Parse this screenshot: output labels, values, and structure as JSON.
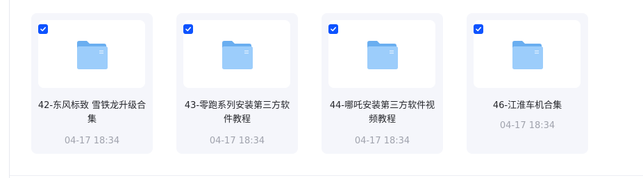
{
  "colors": {
    "accent": "#0d53ff",
    "card_bg": "#f5f6fb",
    "folder_back": "#6aaef0",
    "folder_front": "#9ccdfb",
    "date_text": "#a0a3ad"
  },
  "items": [
    {
      "title": "42-东风标致 雪铁龙升级合集",
      "date": "04-17 18:34",
      "checked": true,
      "icon": "folder-icon"
    },
    {
      "title": "43-零跑系列安装第三方软件教程",
      "date": "04-17 18:34",
      "checked": true,
      "icon": "folder-icon"
    },
    {
      "title": "44-哪吒安装第三方软件视频教程",
      "date": "04-17 18:34",
      "checked": true,
      "icon": "folder-icon"
    },
    {
      "title": "46-江淮车机合集",
      "date": "04-17 18:34",
      "checked": true,
      "icon": "folder-icon"
    }
  ]
}
